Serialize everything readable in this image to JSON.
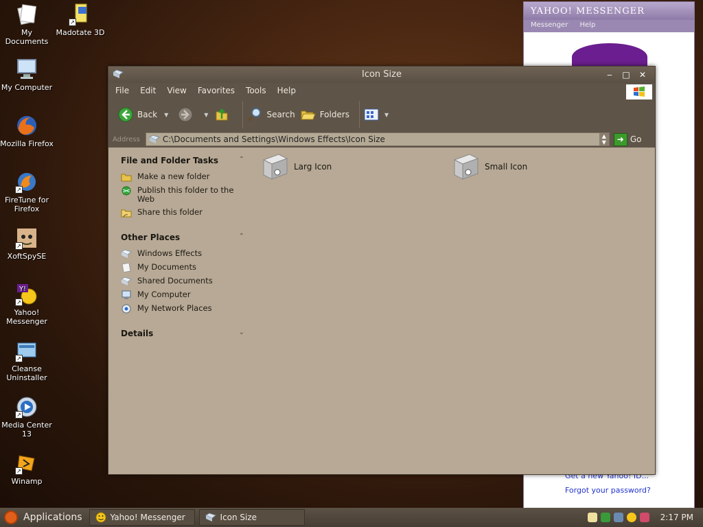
{
  "desktop": {
    "icons": [
      {
        "label": "My Documents"
      },
      {
        "label": "Madotate 3D"
      },
      {
        "label": "My Computer"
      },
      {
        "label": "Mozilla Firefox"
      },
      {
        "label": "FireTune for Firefox"
      },
      {
        "label": "XoftSpySE"
      },
      {
        "label": "Yahoo! Messenger"
      },
      {
        "label": "Cleanse Uninstaller"
      },
      {
        "label": "Media Center 13"
      },
      {
        "label": "Winamp"
      }
    ]
  },
  "yahoo": {
    "title": "YAHOO! MESSENGER",
    "menu": [
      "Messenger",
      "Help"
    ],
    "link_new_id": "Get a new Yahoo! ID...",
    "link_forgot": "Forgot your password?"
  },
  "explorer": {
    "title": "Icon Size",
    "menu": [
      "File",
      "Edit",
      "View",
      "Favorites",
      "Tools",
      "Help"
    ],
    "toolbar": {
      "back": "Back",
      "search": "Search",
      "folders": "Folders"
    },
    "address_label": "Address",
    "address": "C:\\Documents and Settings\\Windows Effects\\Icon Size",
    "go": "Go",
    "tasks": {
      "file_folder_title": "File and Folder Tasks",
      "file_folder_items": [
        "Make a new folder",
        "Publish this folder to the Web",
        "Share this folder"
      ],
      "other_places_title": "Other Places",
      "other_places_items": [
        "Windows Effects",
        "My Documents",
        "Shared Documents",
        "My Computer",
        "My Network Places"
      ],
      "details_title": "Details"
    },
    "files": [
      {
        "name": "Larg Icon"
      },
      {
        "name": "Small Icon"
      }
    ]
  },
  "taskbar": {
    "applications": "Applications",
    "tasks": [
      "Yahoo! Messenger",
      "Icon Size"
    ],
    "clock": "2:17 PM"
  }
}
